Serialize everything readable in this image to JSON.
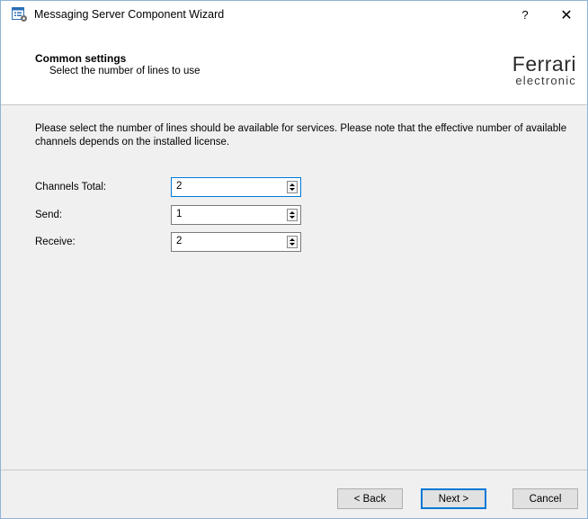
{
  "window": {
    "title": "Messaging Server Component Wizard",
    "help_label": "?",
    "close_label": "✕"
  },
  "header": {
    "title": "Common settings",
    "subtitle": "Select the number of lines to use",
    "logo": {
      "top": "Ferrari",
      "bottom": "electronic"
    }
  },
  "intro_text": "Please select the number of lines should be available for services. Please note that the effective number of available channels depends on the installed license.",
  "fields": [
    {
      "label": "Channels Total:",
      "value": "2"
    },
    {
      "label": "Send:",
      "value": "1"
    },
    {
      "label": "Receive:",
      "value": "2"
    }
  ],
  "buttons": {
    "back": "< Back",
    "next": "Next >",
    "cancel": "Cancel"
  },
  "colors": {
    "focus_accent": "#0078d7",
    "dialog_background": "#f0f0f0"
  }
}
